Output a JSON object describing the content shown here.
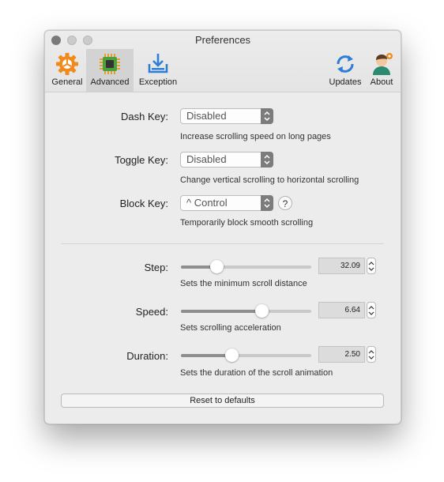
{
  "window": {
    "title": "Preferences"
  },
  "toolbar": {
    "items": [
      {
        "label": "General",
        "icon": "gear-icon",
        "color": "#f08a1c"
      },
      {
        "label": "Advanced",
        "icon": "chip-icon",
        "color": "#4f9f3c",
        "selected": true
      },
      {
        "label": "Exception",
        "icon": "download-tray-icon",
        "color": "#2d7fd6"
      },
      {
        "label": "Updates",
        "icon": "sync-icon",
        "color": "#2d7fd6"
      },
      {
        "label": "About",
        "icon": "user-avatar-icon",
        "color": "#2c8a6e"
      }
    ]
  },
  "keys": {
    "dash": {
      "label": "Dash Key:",
      "value": "Disabled",
      "desc": "Increase scrolling speed on long pages"
    },
    "toggle": {
      "label": "Toggle Key:",
      "value": "Disabled",
      "desc": "Change vertical scrolling to horizontal scrolling"
    },
    "block": {
      "label": "Block Key:",
      "value": "^ Control",
      "desc": "Temporarily block smooth scrolling",
      "help": "?"
    }
  },
  "sliders": {
    "step": {
      "label": "Step:",
      "value": "32.09",
      "desc": "Sets the minimum scroll distance",
      "fraction": 0.27
    },
    "speed": {
      "label": "Speed:",
      "value": "6.64",
      "desc": "Sets scrolling acceleration",
      "fraction": 0.62
    },
    "duration": {
      "label": "Duration:",
      "value": "2.50",
      "desc": "Sets the duration of the scroll animation",
      "fraction": 0.39
    }
  },
  "buttons": {
    "reset": "Reset to defaults"
  }
}
